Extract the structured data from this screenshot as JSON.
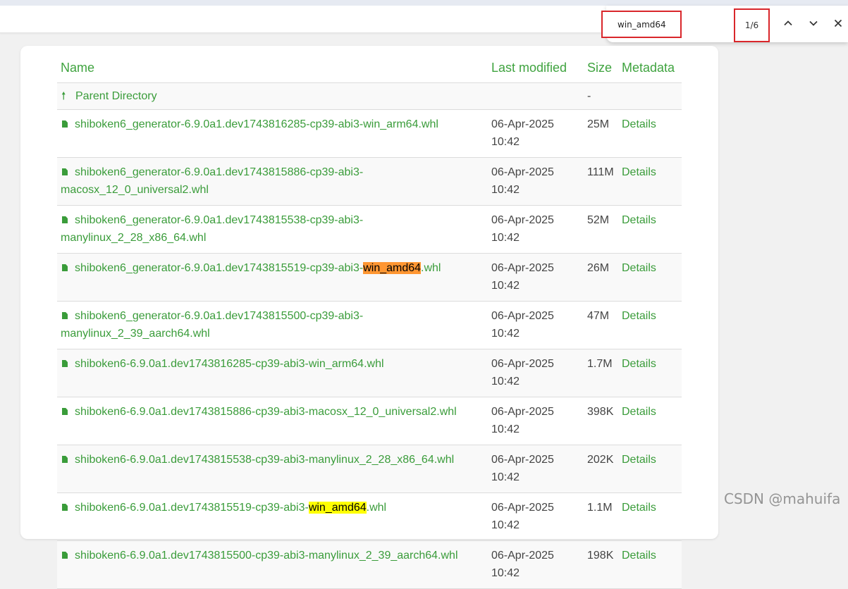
{
  "find": {
    "query": "win_amd64",
    "count": "1/6"
  },
  "table": {
    "headers": {
      "name": "Name",
      "modified": "Last modified",
      "size": "Size",
      "metadata": "Metadata"
    },
    "parent": {
      "label": "Parent Directory",
      "size": "-"
    },
    "rows": [
      {
        "pre": "shiboken6_generator-6.9.0a1.dev1743816285-cp39-abi3-win_arm64.whl",
        "hit": "",
        "post": "",
        "current": false,
        "date": "06-Apr-2025",
        "time": "10:42",
        "size": "25M",
        "details": "Details"
      },
      {
        "pre": "shiboken6_generator-6.9.0a1.dev1743815886-cp39-abi3-macosx_12_0_universal2.whl",
        "hit": "",
        "post": "",
        "current": false,
        "date": "06-Apr-2025",
        "time": "10:42",
        "size": "111M",
        "details": "Details"
      },
      {
        "pre": "shiboken6_generator-6.9.0a1.dev1743815538-cp39-abi3-manylinux_2_28_x86_64.whl",
        "hit": "",
        "post": "",
        "current": false,
        "date": "06-Apr-2025",
        "time": "10:42",
        "size": "52M",
        "details": "Details"
      },
      {
        "pre": "shiboken6_generator-6.9.0a1.dev1743815519-cp39-abi3-",
        "hit": "win_amd64",
        "post": ".whl",
        "current": true,
        "date": "06-Apr-2025",
        "time": "10:42",
        "size": "26M",
        "details": "Details"
      },
      {
        "pre": "shiboken6_generator-6.9.0a1.dev1743815500-cp39-abi3-manylinux_2_39_aarch64.whl",
        "hit": "",
        "post": "",
        "current": false,
        "date": "06-Apr-2025",
        "time": "10:42",
        "size": "47M",
        "details": "Details"
      },
      {
        "pre": "shiboken6-6.9.0a1.dev1743816285-cp39-abi3-win_arm64.whl",
        "hit": "",
        "post": "",
        "current": false,
        "date": "06-Apr-2025",
        "time": "10:42",
        "size": "1.7M",
        "details": "Details"
      },
      {
        "pre": "shiboken6-6.9.0a1.dev1743815886-cp39-abi3-macosx_12_0_universal2.whl",
        "hit": "",
        "post": "",
        "current": false,
        "date": "06-Apr-2025",
        "time": "10:42",
        "size": "398K",
        "details": "Details"
      },
      {
        "pre": "shiboken6-6.9.0a1.dev1743815538-cp39-abi3-manylinux_2_28_x86_64.whl",
        "hit": "",
        "post": "",
        "current": false,
        "date": "06-Apr-2025",
        "time": "10:42",
        "size": "202K",
        "details": "Details"
      },
      {
        "pre": "shiboken6-6.9.0a1.dev1743815519-cp39-abi3-",
        "hit": "win_amd64",
        "post": ".whl",
        "current": false,
        "date": "06-Apr-2025",
        "time": "10:42",
        "size": "1.1M",
        "details": "Details"
      },
      {
        "pre": "shiboken6-6.9.0a1.dev1743815500-cp39-abi3-manylinux_2_39_aarch64.whl",
        "hit": "",
        "post": "",
        "current": false,
        "date": "06-Apr-2025",
        "time": "10:42",
        "size": "198K",
        "details": "Details"
      }
    ]
  },
  "watermark": "CSDN @mahuifa",
  "colors": {
    "link": "#3a9c3a",
    "highlight": "#ffff00",
    "highlight_current": "#ff9632",
    "annotation": "#d9262b"
  }
}
